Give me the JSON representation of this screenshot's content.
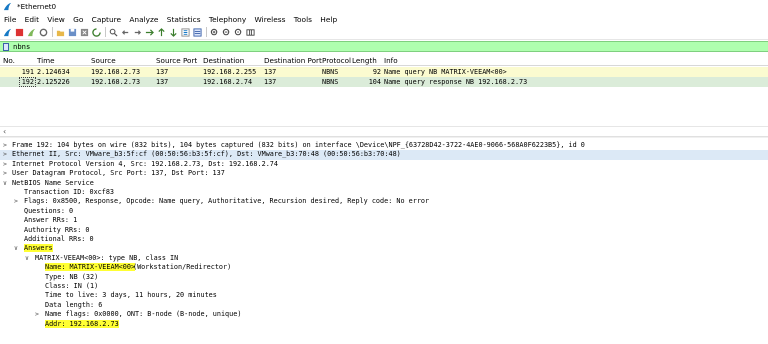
{
  "window": {
    "title": "*Ethernet0"
  },
  "menu": [
    "File",
    "Edit",
    "View",
    "Go",
    "Capture",
    "Analyze",
    "Statistics",
    "Telephony",
    "Wireless",
    "Tools",
    "Help"
  ],
  "filter": {
    "value": "nbns"
  },
  "packet_list": {
    "headers": [
      "No.",
      "Time",
      "Source",
      "Source Port",
      "Destination",
      "Destination Port",
      "Protocol",
      "Length",
      "Info"
    ],
    "rows": [
      {
        "no": "191",
        "time": "2.124634",
        "source": "192.168.2.73",
        "sport": "137",
        "dest": "192.168.2.255",
        "dport": "137",
        "proto": "NBNS",
        "len": "92",
        "info": "Name query NB MATRIX-VEEAM<00>"
      },
      {
        "no": "192",
        "time": "2.125226",
        "source": "192.168.2.73",
        "sport": "137",
        "dest": "192.168.2.74",
        "dport": "137",
        "proto": "NBNS",
        "len": "104",
        "info": "Name query response NB 192.168.2.73"
      }
    ]
  },
  "details": [
    "Frame 192: 104 bytes on wire (832 bits), 104 bytes captured (832 bits) on interface \\Device\\NPF_{63728D42-3722-4AE0-9066-568A0F6223B5}, id 0",
    "Ethernet II, Src: VMware_b3:5f:cf (00:50:56:b3:5f:cf), Dst: VMware_b3:70:48 (00:50:56:b3:70:48)",
    "Internet Protocol Version 4, Src: 192.168.2.73, Dst: 192.168.2.74",
    "User Datagram Protocol, Src Port: 137, Dst Port: 137",
    "NetBIOS Name Service",
    "Transaction ID: 0xcf83",
    "Flags: 0x8500, Response, Opcode: Name query, Authoritative, Recursion desired, Reply code: No error",
    "Questions: 0",
    "Answer RRs: 1",
    "Authority RRs: 0",
    "Additional RRs: 0",
    "Answers",
    "MATRIX-VEEAM<00>: type NB, class IN",
    "Name: MATRIX-VEEAM<00>",
    "(Workstation/Redirector)",
    "Type: NB (32)",
    "Class: IN (1)",
    "Time to live: 3 days, 11 hours, 20 minutes",
    "Data length: 6",
    "Name flags: 0x0000, ONT: B-node (B-node, unique)",
    "Addr: 192.168.2.73"
  ],
  "colors": {
    "filter_bg": "#afffaf",
    "row_query": "#fbfbd0",
    "row_response": "#dbecd9",
    "highlight": "#ffff33",
    "selected_detail": "#dce9f6"
  }
}
